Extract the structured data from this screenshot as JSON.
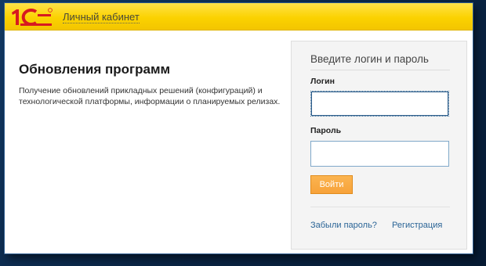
{
  "header": {
    "logo_text": "1С",
    "cabinet_link": "Личный кабинет"
  },
  "main": {
    "title": "Обновления программ",
    "description": "Получение обновлений прикладных решений (конфигураций) и технологической платформы, информации о планируемых релизах."
  },
  "login_panel": {
    "title": "Введите логин и пароль",
    "login_label": "Логин",
    "login_value": "",
    "password_label": "Пароль",
    "password_value": "",
    "submit_label": "Войти",
    "forgot_link": "Забыли пароль?",
    "register_link": "Регистрация"
  },
  "colors": {
    "header_yellow": "#fbd200",
    "logo_red": "#d71920",
    "submit_orange": "#f7a23a",
    "link_blue": "#2a6496",
    "outer_background": "#0b2b4e"
  }
}
